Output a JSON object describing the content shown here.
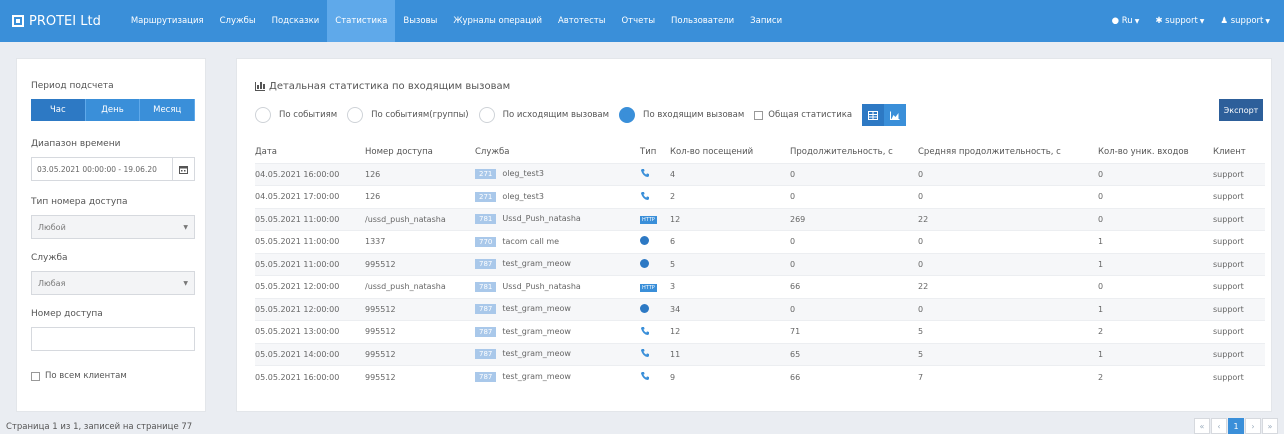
{
  "brand": {
    "name": "PROTEI Ltd"
  },
  "nav": {
    "items": [
      "Маршрутизация",
      "Службы",
      "Подсказки",
      "Статистика",
      "Вызовы",
      "Журналы операций",
      "Автотесты",
      "Отчеты",
      "Пользователи",
      "Записи"
    ],
    "active_index": 3,
    "right": {
      "lang": "Ru",
      "support1": "support",
      "support2": "support"
    }
  },
  "left": {
    "period_label": "Период подсчета",
    "period_options": [
      "Час",
      "День",
      "Месяц"
    ],
    "period_active": 0,
    "range_label": "Диапазон времени",
    "range_value": "03.05.2021 00:00:00 - 19.06.20",
    "access_type_label": "Тип номера доступа",
    "access_type_value": "Любой",
    "service_label": "Служба",
    "service_value": "Любая",
    "access_number_label": "Номер доступа",
    "all_clients_label": "По всем клиентам"
  },
  "main": {
    "title": "Детальная статистика по входящим вызовам",
    "radios": [
      "По событиям",
      "По событиям(группы)",
      "По исходящим вызовам",
      "По входящим вызовам"
    ],
    "radio_checked": 3,
    "general_stats_label": "Общая статистика",
    "export_label": "Экспорт",
    "columns": [
      "Дата",
      "Номер доступа",
      "Служба",
      "Тип",
      "Кол-во посещений",
      "Продолжительность, с",
      "Средняя продолжительность, с",
      "Кол-во уник. входов",
      "Клиент"
    ],
    "rows": [
      {
        "date": "04.05.2021 16:00:00",
        "number": "126",
        "badge": "271",
        "service": "oleg_test3",
        "type": "phone",
        "visits": "4",
        "duration": "0",
        "avg": "0",
        "unique": "0",
        "client": "support"
      },
      {
        "date": "04.05.2021 17:00:00",
        "number": "126",
        "badge": "271",
        "service": "oleg_test3",
        "type": "phone",
        "visits": "2",
        "duration": "0",
        "avg": "0",
        "unique": "0",
        "client": "support"
      },
      {
        "date": "05.05.2021 11:00:00",
        "number": "/ussd_push_natasha",
        "badge": "781",
        "service": "Ussd_Push_natasha",
        "type": "http",
        "visits": "12",
        "duration": "269",
        "avg": "22",
        "unique": "0",
        "client": "support"
      },
      {
        "date": "05.05.2021 11:00:00",
        "number": "1337",
        "badge": "770",
        "service": "tacom call me",
        "type": "telegram",
        "visits": "6",
        "duration": "0",
        "avg": "0",
        "unique": "1",
        "client": "support"
      },
      {
        "date": "05.05.2021 11:00:00",
        "number": "995512",
        "badge": "787",
        "service": "test_gram_meow",
        "type": "telegram",
        "visits": "5",
        "duration": "0",
        "avg": "0",
        "unique": "1",
        "client": "support"
      },
      {
        "date": "05.05.2021 12:00:00",
        "number": "/ussd_push_natasha",
        "badge": "781",
        "service": "Ussd_Push_natasha",
        "type": "http",
        "visits": "3",
        "duration": "66",
        "avg": "22",
        "unique": "0",
        "client": "support"
      },
      {
        "date": "05.05.2021 12:00:00",
        "number": "995512",
        "badge": "787",
        "service": "test_gram_meow",
        "type": "telegram",
        "visits": "34",
        "duration": "0",
        "avg": "0",
        "unique": "1",
        "client": "support"
      },
      {
        "date": "05.05.2021 13:00:00",
        "number": "995512",
        "badge": "787",
        "service": "test_gram_meow",
        "type": "phone",
        "visits": "12",
        "duration": "71",
        "avg": "5",
        "unique": "2",
        "client": "support"
      },
      {
        "date": "05.05.2021 14:00:00",
        "number": "995512",
        "badge": "787",
        "service": "test_gram_meow",
        "type": "phone",
        "visits": "11",
        "duration": "65",
        "avg": "5",
        "unique": "1",
        "client": "support"
      },
      {
        "date": "05.05.2021 16:00:00",
        "number": "995512",
        "badge": "787",
        "service": "test_gram_meow",
        "type": "phone",
        "visits": "9",
        "duration": "66",
        "avg": "7",
        "unique": "2",
        "client": "support"
      }
    ]
  },
  "footer": {
    "summary": "Страница 1 из 1, записей на странице 77",
    "current_page": "1"
  },
  "colors": {
    "primary": "#3a8fd9",
    "primary_dark": "#2d79c4",
    "export": "#2d5f9a"
  }
}
